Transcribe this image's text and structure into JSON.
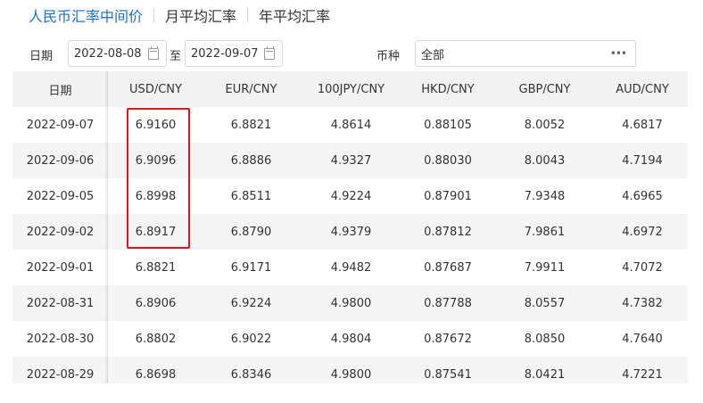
{
  "tabs": [
    "人民币汇率中间价",
    "月平均汇率",
    "年平均汇率"
  ],
  "filters": {
    "date_label": "日期",
    "start_date": "2022-08-08",
    "to_label": "至",
    "end_date": "2022-09-07",
    "currency_label": "币种",
    "currency_value": "全部"
  },
  "table": {
    "headers": [
      "日期",
      "USD/CNY",
      "EUR/CNY",
      "100JPY/CNY",
      "HKD/CNY",
      "GBP/CNY",
      "AUD/CNY"
    ],
    "rows": [
      [
        "2022-09-07",
        "6.9160",
        "6.8821",
        "4.8614",
        "0.88105",
        "8.0052",
        "4.6817"
      ],
      [
        "2022-09-06",
        "6.9096",
        "6.8886",
        "4.9327",
        "0.88030",
        "8.0043",
        "4.7194"
      ],
      [
        "2022-09-05",
        "6.8998",
        "6.8511",
        "4.9224",
        "0.87901",
        "7.9348",
        "4.6965"
      ],
      [
        "2022-09-02",
        "6.8917",
        "6.8790",
        "4.9379",
        "0.87812",
        "7.9861",
        "4.6972"
      ],
      [
        "2022-09-01",
        "6.8821",
        "6.9171",
        "4.9482",
        "0.87687",
        "7.9911",
        "4.7072"
      ],
      [
        "2022-08-31",
        "6.8906",
        "6.9224",
        "4.9800",
        "0.87788",
        "8.0557",
        "4.7382"
      ],
      [
        "2022-08-30",
        "6.8802",
        "6.9022",
        "4.9804",
        "0.87672",
        "8.0850",
        "4.7640"
      ],
      [
        "2022-08-29",
        "6.8698",
        "6.8346",
        "4.9800",
        "0.87541",
        "8.0421",
        "4.7221"
      ]
    ]
  },
  "colors": {
    "active_tab": "#1f6fc9",
    "highlight_border": "#e0151f",
    "header_bg": "#f2f2f2",
    "stripe_bg": "#f5f5f5"
  },
  "icons": {
    "calendar": "calendar-icon",
    "more": "more-dots-icon"
  }
}
